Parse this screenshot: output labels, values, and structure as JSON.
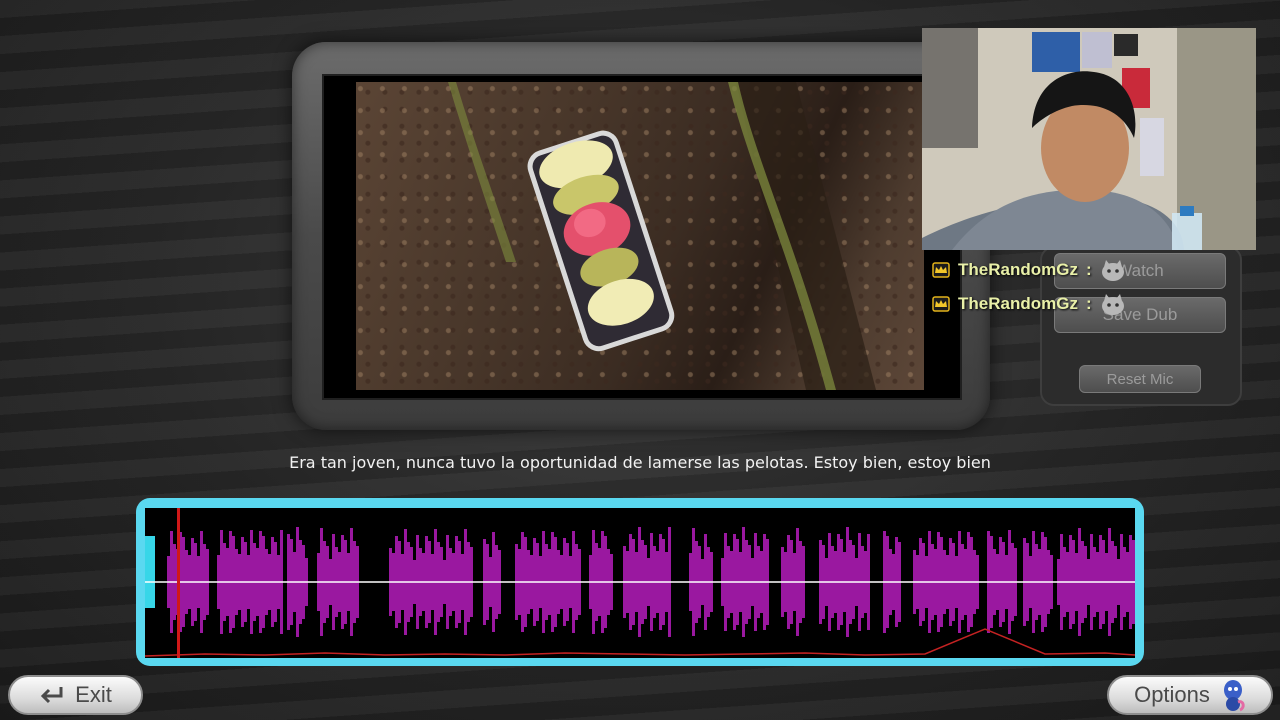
{
  "video": {
    "caption": "Era tan joven, nunca tuvo la oportunidad de lamerse las pelotas. Estoy bien, estoy bien"
  },
  "panel": {
    "watch_label": "Watch",
    "save_dub_label": "Save Dub",
    "reset_mic_label": "Reset Mic"
  },
  "chat": {
    "messages": [
      {
        "user": "TheRandomGz",
        "separator": ":"
      },
      {
        "user": "TheRandomGz",
        "separator": ":"
      }
    ]
  },
  "footer": {
    "exit_label": "Exit",
    "options_label": "Options"
  },
  "icons": {
    "exit": "return-arrow-icon",
    "chat_badge": "crown-icon",
    "chat_emote": "cat-emote-icon"
  },
  "colors": {
    "waveform": "#c01ec8",
    "waveform_border": "#5ad8f0",
    "playhead": "#d01818",
    "chat_name": "#e9f0a8"
  }
}
